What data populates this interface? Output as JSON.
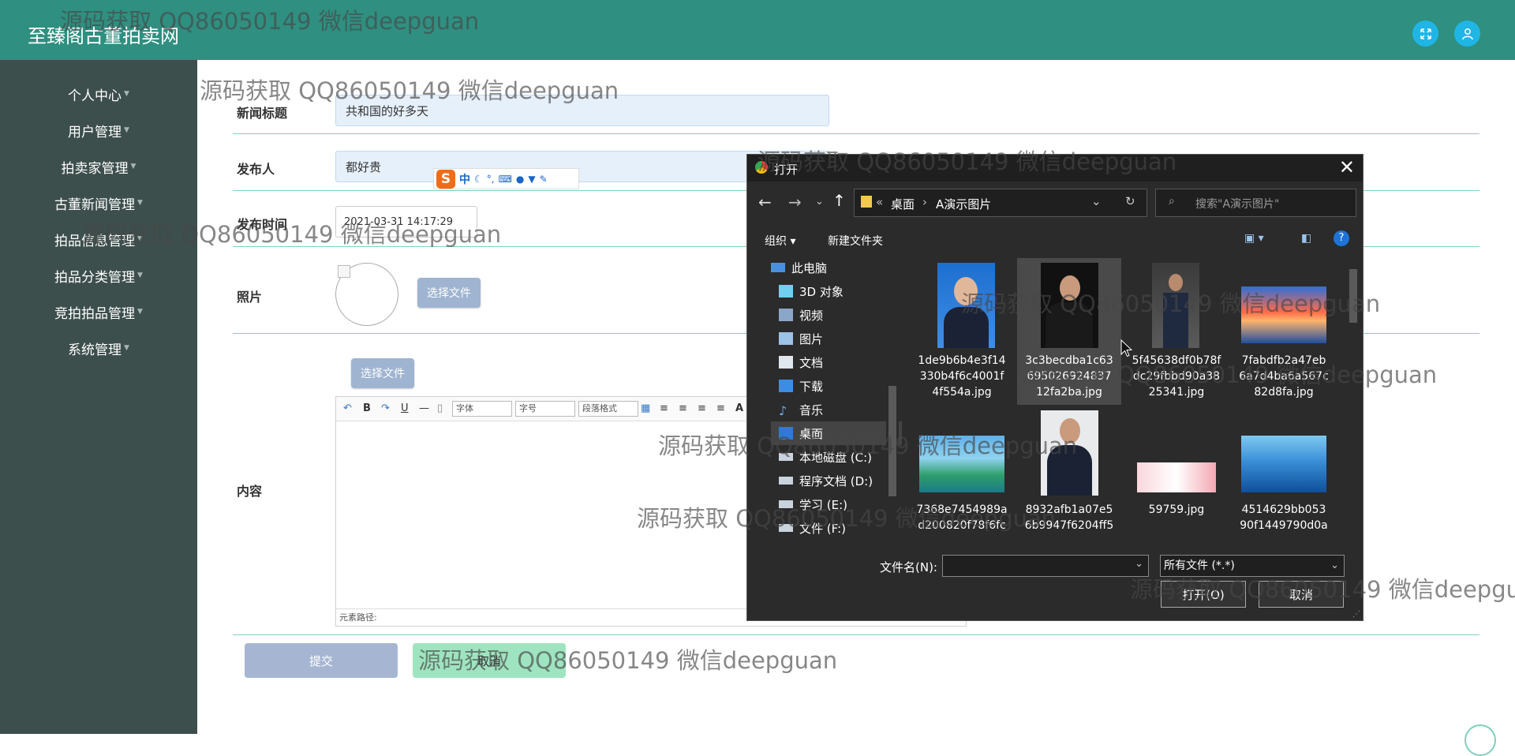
{
  "app": {
    "title": "至臻阁古董拍卖网"
  },
  "sidebar": {
    "items": [
      {
        "label": "个人中心"
      },
      {
        "label": "用户管理"
      },
      {
        "label": "拍卖家管理"
      },
      {
        "label": "古董新闻管理"
      },
      {
        "label": "拍品信息管理"
      },
      {
        "label": "拍品分类管理"
      },
      {
        "label": "竞拍拍品管理"
      },
      {
        "label": "系统管理"
      }
    ]
  },
  "form": {
    "title_label": "新闻标题",
    "title_value": "共和国的好多天",
    "publisher_label": "发布人",
    "publisher_value": "都好贵",
    "time_label": "发布时间",
    "time_value": "2021-03-31 14:17:29",
    "photo_label": "照片",
    "choose_file": "选择文件",
    "content_label": "内容",
    "content_choose_file": "选择文件",
    "submit": "提交",
    "cancel": "取消"
  },
  "editor": {
    "font_select": "字体",
    "size_select": "字号",
    "para_select": "段落格式",
    "footer": "元素路径:"
  },
  "ime": {
    "mode": "中"
  },
  "dialog": {
    "title": "打开",
    "breadcrumb": [
      "桌面",
      "A演示图片"
    ],
    "search_placeholder": "搜索\"A演示图片\"",
    "organize": "组织",
    "new_folder": "新建文件夹",
    "nav": [
      {
        "label": "此电脑",
        "icon": "computer-icon"
      },
      {
        "label": "3D 对象",
        "icon": "cube-icon"
      },
      {
        "label": "视频",
        "icon": "video-icon"
      },
      {
        "label": "图片",
        "icon": "picture-icon"
      },
      {
        "label": "文档",
        "icon": "document-icon"
      },
      {
        "label": "下载",
        "icon": "download-icon"
      },
      {
        "label": "音乐",
        "icon": "music-icon"
      },
      {
        "label": "桌面",
        "icon": "desktop-icon"
      },
      {
        "label": "本地磁盘 (C:)",
        "icon": "drive-icon"
      },
      {
        "label": "程序文档 (D:)",
        "icon": "drive-icon"
      },
      {
        "label": "学习 (E:)",
        "icon": "drive-icon"
      },
      {
        "label": "文件 (F:)",
        "icon": "drive-icon"
      }
    ],
    "files": [
      {
        "name_lines": [
          "1de9b6b4e3f14",
          "330b4f6c4001f",
          "4f554a.jpg"
        ]
      },
      {
        "name_lines": [
          "3c3becdba1c63",
          "695026924837",
          "12fa2ba.jpg"
        ]
      },
      {
        "name_lines": [
          "5f45638df0b78f",
          "dc29fbbd90a38",
          "25341.jpg"
        ]
      },
      {
        "name_lines": [
          "7fabdfb2a47eb",
          "6a7d4ba6a567c",
          "82d8fa.jpg"
        ]
      },
      {
        "name_lines": [
          "7368e7454989a",
          "d200820f78f6fc"
        ]
      },
      {
        "name_lines": [
          "8932afb1a07e5",
          "6b9947f6204ff5"
        ]
      },
      {
        "name_lines": [
          "59759.jpg"
        ]
      },
      {
        "name_lines": [
          "4514629bb053",
          "90f1449790d0a"
        ]
      }
    ],
    "filename_label": "文件名(N):",
    "filename_value": "",
    "filetype": "所有文件 (*.*)",
    "open_button": "打开(O)",
    "cancel_button": "取消"
  },
  "watermark": "源码获取 QQ86050149 微信deepguan",
  "colors": {
    "header": "#2f8f80",
    "sidebar": "#3d4f4d",
    "accent_button": "#1fb6e6",
    "dialog_bg": "#2b2b2b"
  }
}
